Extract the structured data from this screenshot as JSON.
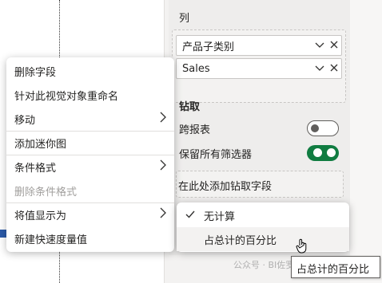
{
  "pane": {
    "columns_label": "列",
    "fields": [
      {
        "label": "产品子类别",
        "chevron_icon": "chevron-down-icon",
        "close_icon": "close-icon"
      },
      {
        "label": "Sales",
        "chevron_icon": "chevron-down-icon",
        "close_icon": "close-icon"
      }
    ],
    "drillthrough_label": "钻取",
    "cross_report": {
      "label": "跨报表",
      "state": "off"
    },
    "keep_filters": {
      "label": "保留所有筛选器",
      "state": "on"
    },
    "drill_placeholder": "在此处添加钻取字段"
  },
  "context_menu": {
    "items": [
      {
        "label": "删除字段",
        "disabled": false,
        "has_submenu": false
      },
      {
        "label": "针对此视觉对象重命名",
        "disabled": false,
        "has_submenu": false
      },
      {
        "label": "移动",
        "disabled": false,
        "has_submenu": true
      },
      {
        "label": "添加迷你图",
        "disabled": false,
        "has_submenu": false
      },
      {
        "label": "条件格式",
        "disabled": false,
        "has_submenu": true
      },
      {
        "label": "删除条件格式",
        "disabled": true,
        "has_submenu": false
      },
      {
        "label": "将值显示为",
        "disabled": false,
        "has_submenu": true
      },
      {
        "label": "新建快速度量值",
        "disabled": false,
        "has_submenu": false
      }
    ]
  },
  "submenu": {
    "items": [
      {
        "label": "无计算",
        "checked": true
      },
      {
        "label": "占总计的百分比",
        "checked": false
      }
    ]
  },
  "tooltip": "占总计的百分比",
  "watermark": "公众号 · BI佐罗讲数据分析",
  "colors": {
    "toggle_on": "#107c41",
    "pane_bg": "#f3f2f1"
  }
}
